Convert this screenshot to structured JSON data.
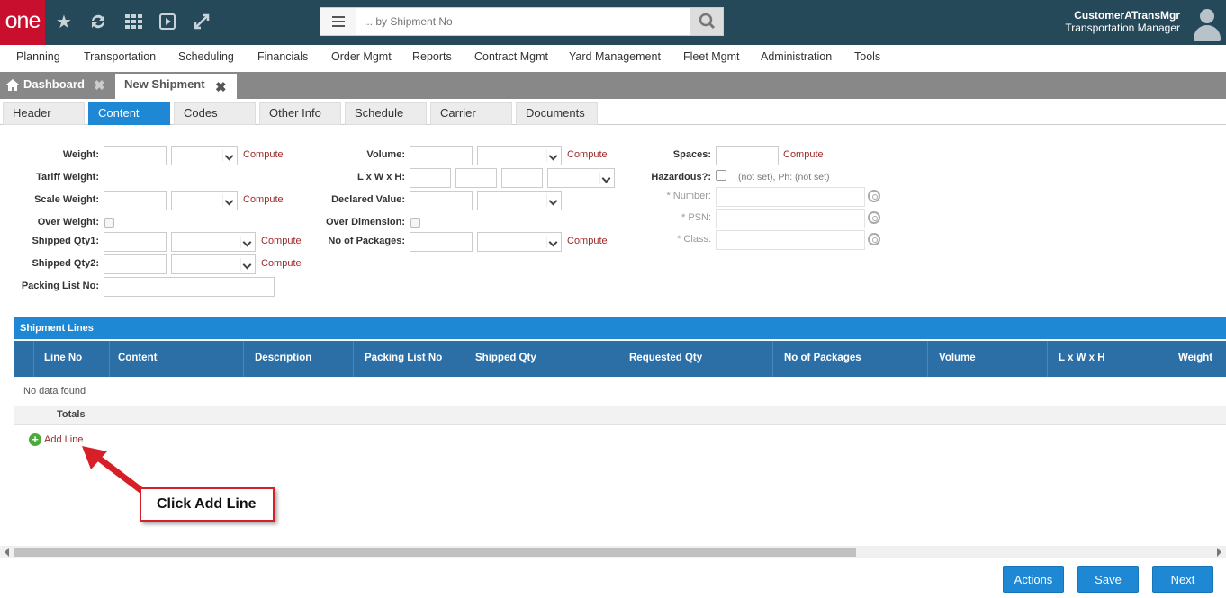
{
  "header": {
    "logo": "one",
    "search_placeholder": "... by Shipment No",
    "user_name": "CustomerATransMgr",
    "user_role": "Transportation Manager"
  },
  "menu": [
    "Planning",
    "Transportation",
    "Scheduling",
    "Financials",
    "Order Mgmt",
    "Reports",
    "Contract Mgmt",
    "Yard Management",
    "Fleet Mgmt",
    "Administration",
    "Tools"
  ],
  "tabs": {
    "dashboard": "Dashboard",
    "new_shipment": "New Shipment"
  },
  "subtabs": [
    "Header",
    "Content",
    "Codes",
    "Other Info",
    "Schedule",
    "Carrier",
    "Documents"
  ],
  "form": {
    "weight": "Weight:",
    "tariff_weight": "Tariff Weight:",
    "scale_weight": "Scale Weight:",
    "over_weight": "Over Weight:",
    "shipped_qty1": "Shipped Qty1:",
    "shipped_qty2": "Shipped Qty2:",
    "packing_list_no": "Packing List No:",
    "volume": "Volume:",
    "lwh": "L x W x H:",
    "declared_value": "Declared Value:",
    "over_dimension": "Over Dimension:",
    "no_of_packages": "No of Packages:",
    "spaces": "Spaces:",
    "hazardous": "Hazardous?:",
    "hazardous_note": "(not set), Ph: (not set)",
    "number": "* Number:",
    "psn": "* PSN:",
    "class": "* Class:",
    "compute": "Compute"
  },
  "grid": {
    "title": "Shipment Lines",
    "columns": [
      "Line No",
      "Content",
      "Description",
      "Packing List No",
      "Shipped Qty",
      "Requested Qty",
      "No of Packages",
      "Volume",
      "L x W x H",
      "Weight"
    ],
    "empty": "No data found",
    "totals": "Totals",
    "add_line": "Add Line"
  },
  "callout": "Click Add Line",
  "buttons": {
    "actions": "Actions",
    "save": "Save",
    "next": "Next"
  },
  "colors": {
    "topbar": "#26495a",
    "accent": "#1e88d4",
    "brand": "#c8102e",
    "callout": "#d61f26"
  }
}
